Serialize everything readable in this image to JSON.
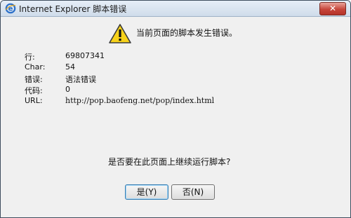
{
  "window": {
    "title": "Internet Explorer 脚本错误",
    "close_label": "✕"
  },
  "dialog": {
    "heading": "当前页面的脚本发生错误。",
    "details": [
      {
        "label": "行:",
        "value": "69807341"
      },
      {
        "label": "Char:",
        "value": "54"
      },
      {
        "label": "错误:",
        "value": "语法错误"
      },
      {
        "label": "代码:",
        "value": "0"
      },
      {
        "label": "URL:",
        "value": "http://pop.baofeng.net/pop/index.html"
      }
    ],
    "question": "是否要在此页面上继续运行脚本?",
    "yes_label": "是(Y)",
    "no_label": "否(N)"
  },
  "colors": {
    "warning_yellow": "#f7d21a",
    "ie_blue": "#2a6fc9"
  },
  "icons": {
    "app": "internet-explorer-icon",
    "warning": "warning-triangle-icon"
  }
}
